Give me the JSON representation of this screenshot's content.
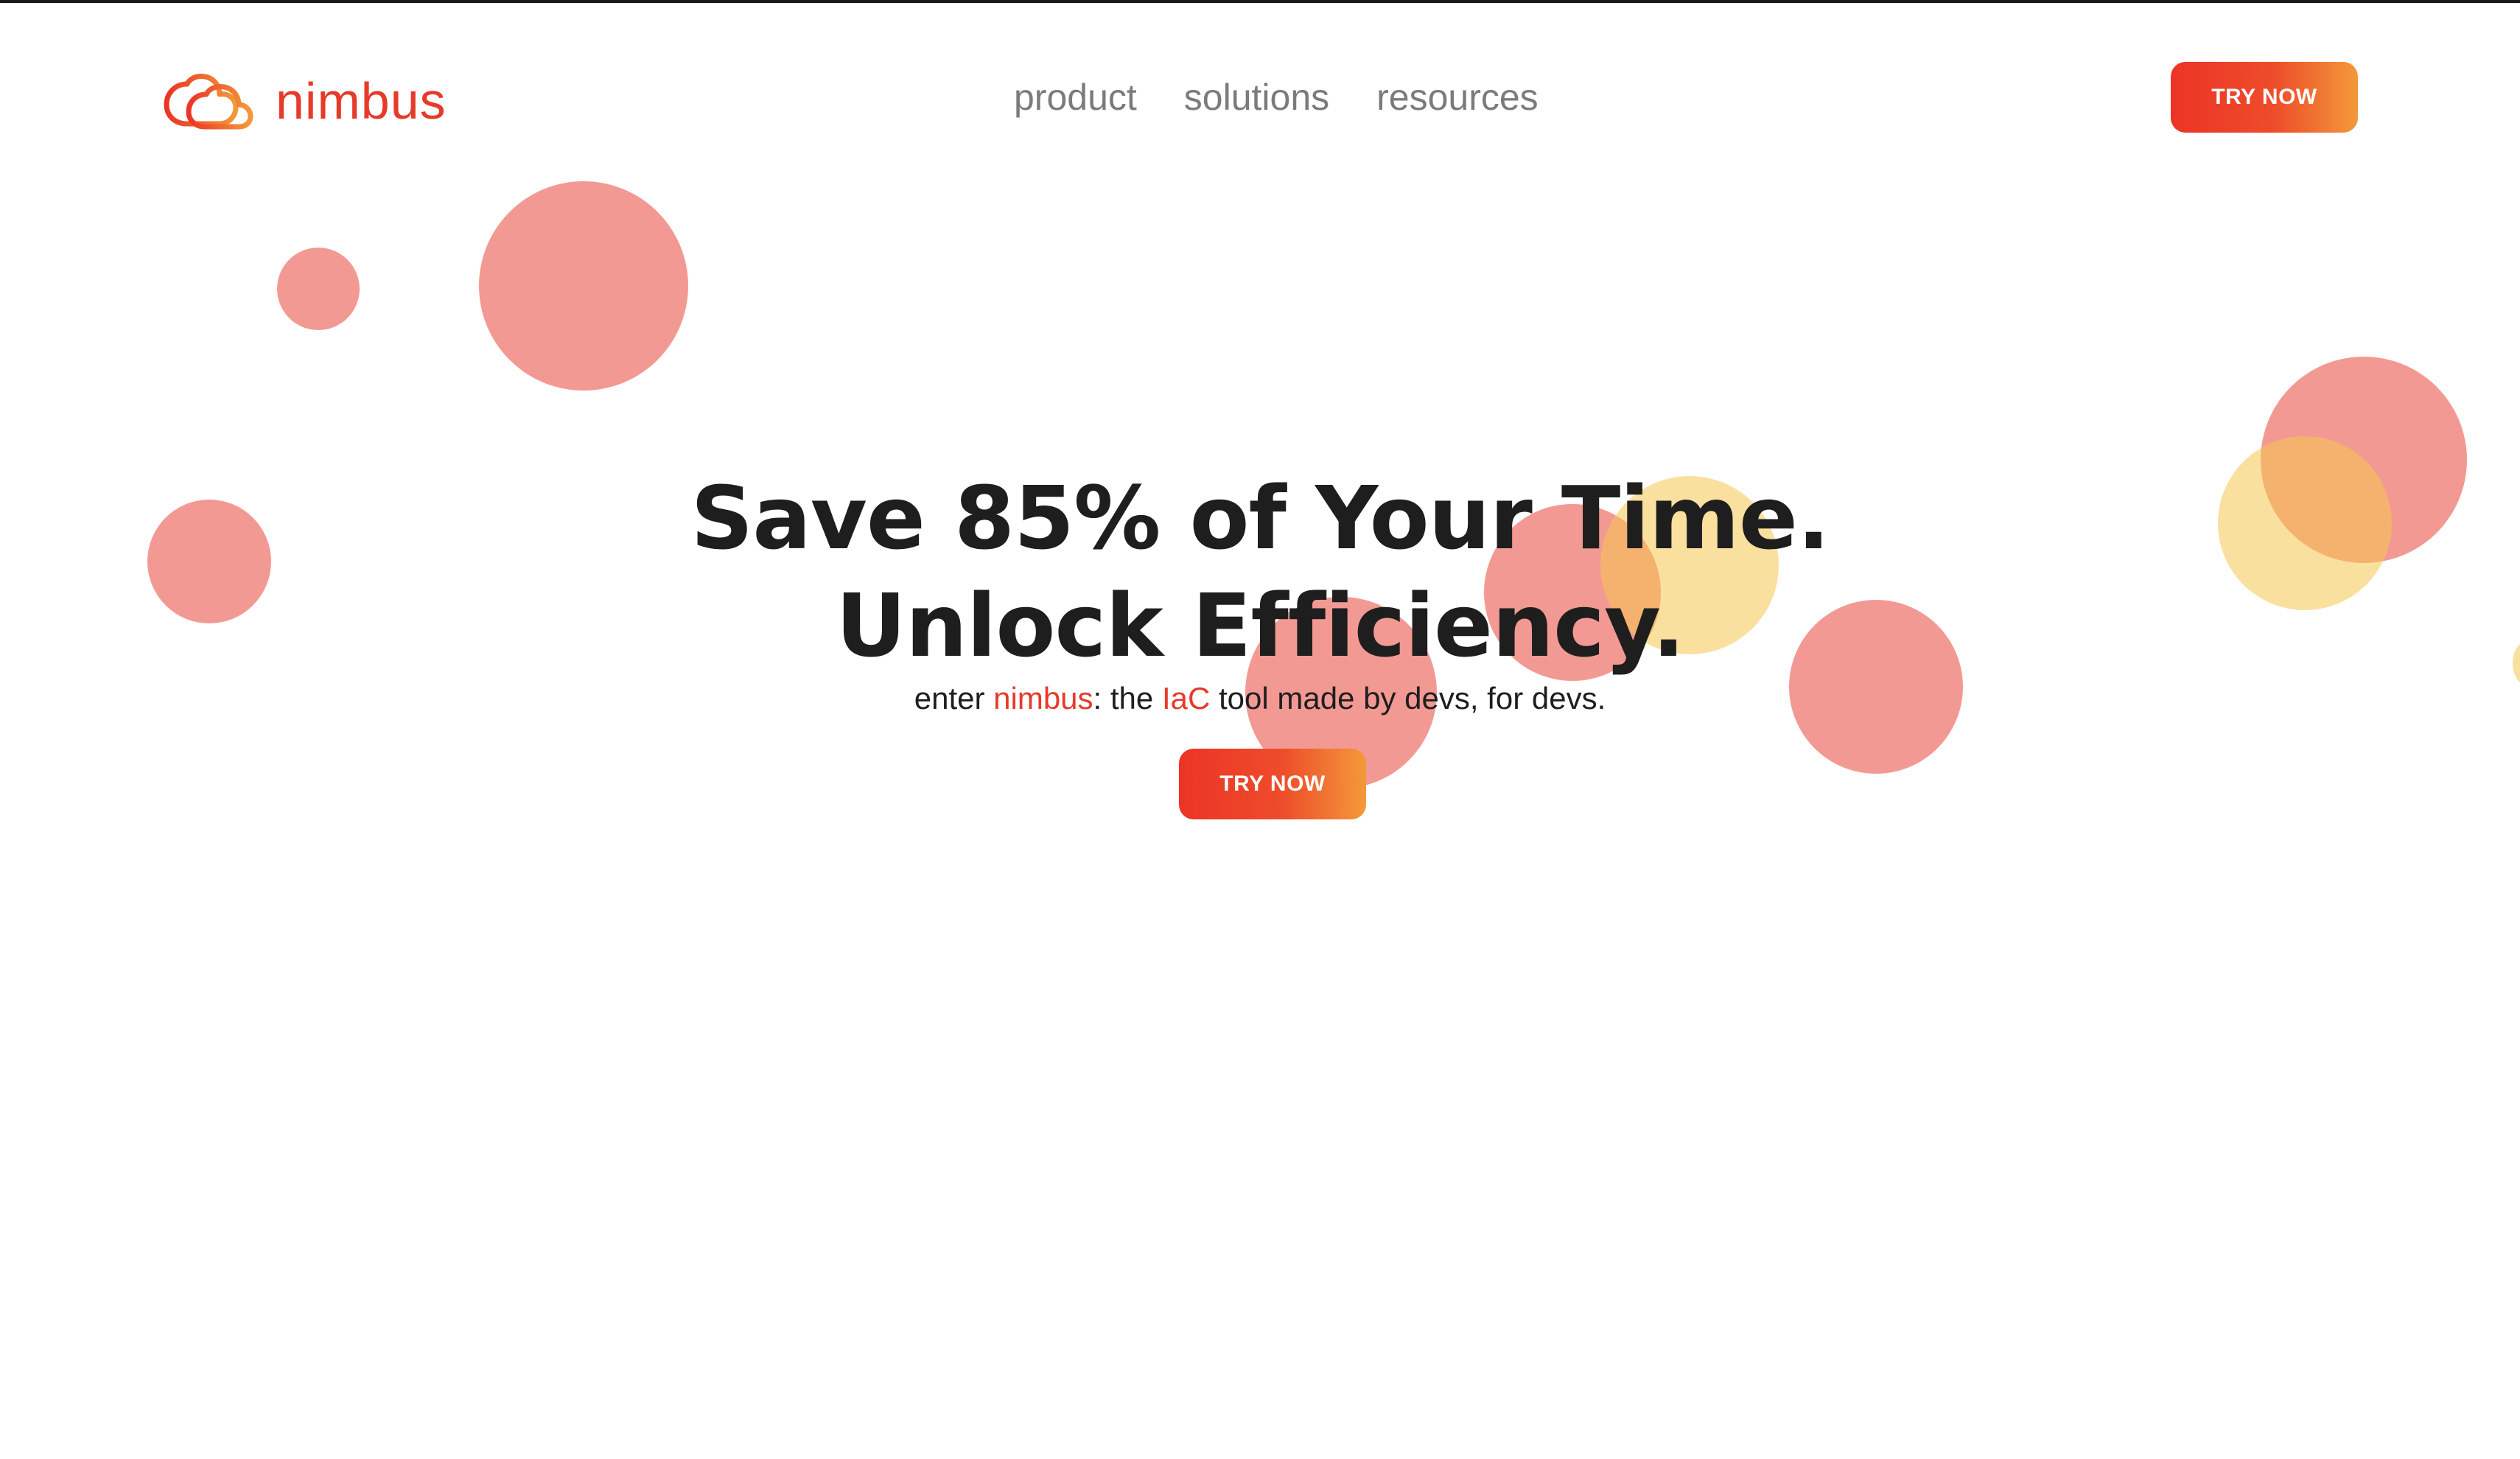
{
  "brand": {
    "name": "nimbus",
    "logo_icon": "cloud-icon",
    "accent_color": "#e63a2a",
    "gradient_start": "#ec3426",
    "gradient_end": "#f3993a"
  },
  "nav": {
    "items": [
      {
        "label": "product"
      },
      {
        "label": "solutions"
      },
      {
        "label": "resources"
      }
    ]
  },
  "header": {
    "cta_label": "TRY NOW"
  },
  "hero": {
    "title_line1": "Save 85% of Your Time.",
    "title_line2": "Unlock Efficiency.",
    "subtitle": {
      "part1": "enter ",
      "brand": "nimbus",
      "part2": ": the ",
      "iac": "IaC",
      "part3": " tool made by devs, for devs."
    },
    "cta_label": "TRY NOW"
  }
}
